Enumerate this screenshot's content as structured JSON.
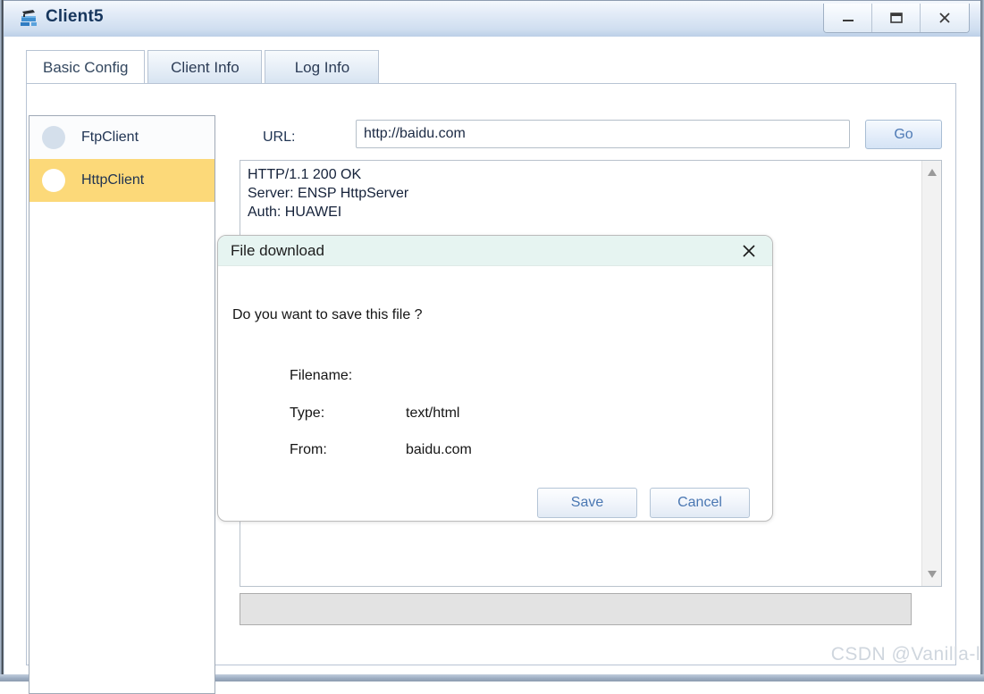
{
  "window": {
    "title": "Client5",
    "icon": "device-icon",
    "controls": [
      {
        "name": "minimize-button",
        "icon": "minimize-icon",
        "label": "_"
      },
      {
        "name": "maximize-button",
        "icon": "maximize-icon",
        "label": "☐"
      },
      {
        "name": "close-button",
        "icon": "close-icon",
        "label": "X"
      }
    ]
  },
  "tabs": [
    {
      "label": "Basic Config",
      "active": false
    },
    {
      "label": "Client Info",
      "active": true
    },
    {
      "label": "Log Info",
      "active": false
    }
  ],
  "sidebar": {
    "items": [
      {
        "label": "FtpClient",
        "selected": false,
        "bullet_color": "#d4dfeb"
      },
      {
        "label": "HttpClient",
        "selected": true,
        "bullet_color": "#ffffff"
      }
    ],
    "selected_background": "#fcd979"
  },
  "main": {
    "url_label": "URL:",
    "url_value": "http://baidu.com",
    "url_placeholder": "",
    "go_label": "Go",
    "response_text": "HTTP/1.1 200 OK\nServer: ENSP HttpServer\nAuth: HUAWEI",
    "status_text": ""
  },
  "dialog": {
    "title": "File download",
    "close_icon": "close-icon",
    "question": "Do you want to save this file ?",
    "fields": [
      {
        "key": "Filename:",
        "value": ""
      },
      {
        "key": "Type:",
        "value": "text/html"
      },
      {
        "key": "From:",
        "value": "baidu.com"
      }
    ],
    "save_label": "Save",
    "cancel_label": "Cancel"
  },
  "watermark": {
    "text": "CSDN @Vanilla-l"
  },
  "colors": {
    "title_bar_top": "#f4f8fd",
    "title_bar_bottom": "#bcd0e7",
    "selection_yellow": "#fcd979",
    "dialog_title_bar": "#e6f4f1",
    "button_text_blue": "#4a77b2",
    "title_text": "#17365d"
  }
}
